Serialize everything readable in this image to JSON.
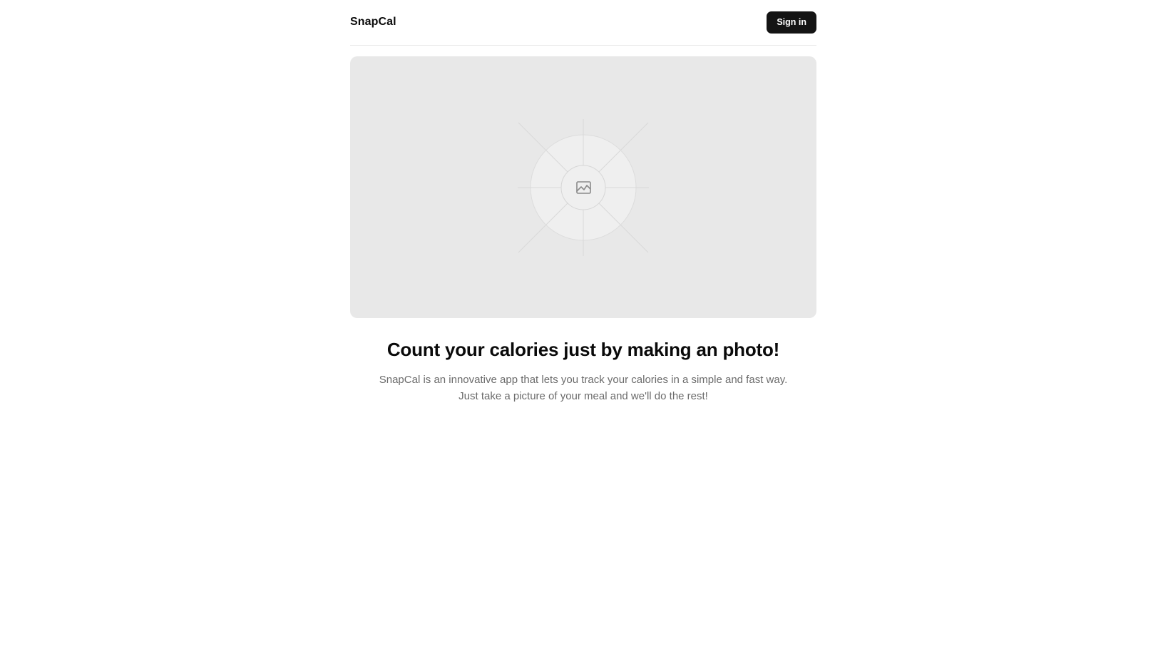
{
  "header": {
    "brand": "SnapCal",
    "signin_label": "Sign in"
  },
  "hero": {
    "icon": "image-placeholder-icon"
  },
  "main": {
    "headline": "Count your calories just by making an photo!",
    "description": "SnapCal is an innovative app that lets you track your calories in a simple and fast way. Just take a picture of your meal and we'll do the rest!"
  },
  "colors": {
    "button_bg": "#141414",
    "placeholder_bg": "#e8e8e8",
    "muted_text": "#6b6b6b"
  }
}
